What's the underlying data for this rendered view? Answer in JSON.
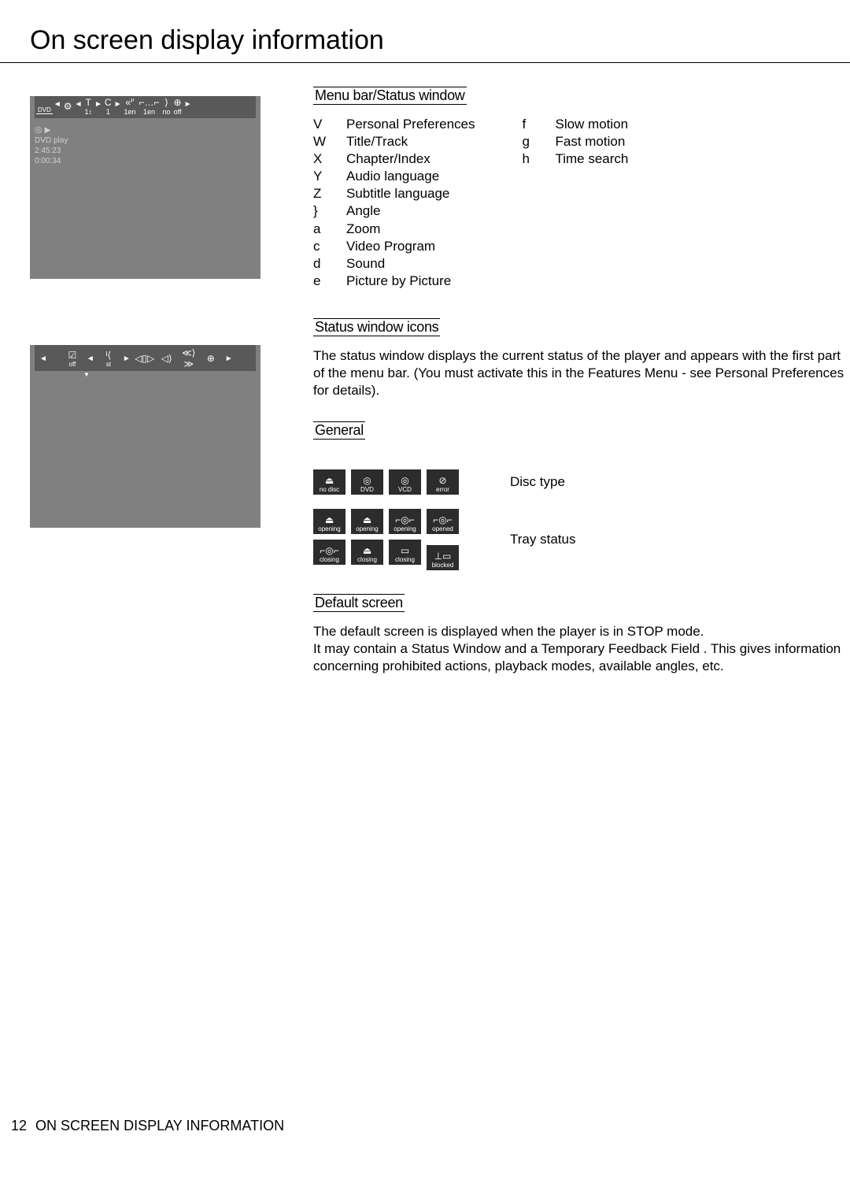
{
  "page_title": "On screen display information",
  "footer": {
    "page_num": "12",
    "label": "ON SCREEN DISPLAY INFORMATION"
  },
  "sections": {
    "menu_bar": {
      "heading": "Menu bar/Status window",
      "col1": [
        {
          "k": "V",
          "v": "Personal Preferences"
        },
        {
          "k": "W",
          "v": "Title/Track"
        },
        {
          "k": "X",
          "v": "Chapter/Index"
        },
        {
          "k": "Y",
          "v": "Audio language"
        },
        {
          "k": "Z",
          "v": "Subtitle language"
        },
        {
          "k": "}",
          "v": "Angle"
        },
        {
          "k": "a",
          "v": "Zoom"
        },
        {
          "k": "c",
          "v": "Video Program"
        },
        {
          "k": "d",
          "v": "Sound"
        },
        {
          "k": "e",
          "v": "Picture by Picture"
        }
      ],
      "col2": [
        {
          "k": "f",
          "v": "Slow motion"
        },
        {
          "k": "g",
          "v": "Fast motion"
        },
        {
          "k": "h",
          "v": "Time search"
        }
      ]
    },
    "status_icons": {
      "heading": "Status window icons",
      "para": "The status window displays the current status of the player and appears with the first part of the menu bar. (You must activate this in the Features Menu - see Personal Preferences for details)."
    },
    "general": {
      "heading": "General",
      "disc_type_label": "Disc type",
      "disc_tiles": [
        "no disc",
        "DVD",
        "VCD",
        "error"
      ],
      "tray_status_label": "Tray status",
      "tray_tiles": [
        "opening",
        "opening",
        "opening",
        "opened",
        "closing",
        "closing",
        "closing",
        "blocked"
      ]
    },
    "default_screen": {
      "heading": "Default screen",
      "para": "The default screen is displayed when the player is in STOP mode.\nIt may contain a Status Window and a Temporary Feedback Field . This gives information concerning prohibited actions, playback modes, available angles, etc."
    }
  },
  "osd1": {
    "dvd": "DVD",
    "cells": [
      {
        "top": "⚙",
        "bot": ""
      },
      {
        "top": "T",
        "bot": "1↕"
      },
      {
        "top": "C",
        "bot": "1"
      },
      {
        "top": "«ᑊ'",
        "bot": "1en"
      },
      {
        "top": "⌐…⌐",
        "bot": "1en"
      },
      {
        "top": "⟩",
        "bot": "no"
      },
      {
        "top": "⊕",
        "bot": "off"
      }
    ],
    "status": {
      "disc": "◎",
      "play": "▶",
      "l1a": "DVD",
      "l1b": "play",
      "l2": "2:45:23",
      "l3": "0:00:34"
    }
  },
  "osd2": {
    "cells": [
      {
        "ico": "☑",
        "sub": "off"
      },
      {
        "ico": "ᴵ⟨",
        "sub": "st"
      },
      {
        "ico": "◁▯▷",
        "sub": ""
      },
      {
        "ico": "◁⟩",
        "sub": ""
      },
      {
        "ico": "≪⟩≫",
        "sub": ""
      },
      {
        "ico": "⊕",
        "sub": ""
      }
    ]
  }
}
